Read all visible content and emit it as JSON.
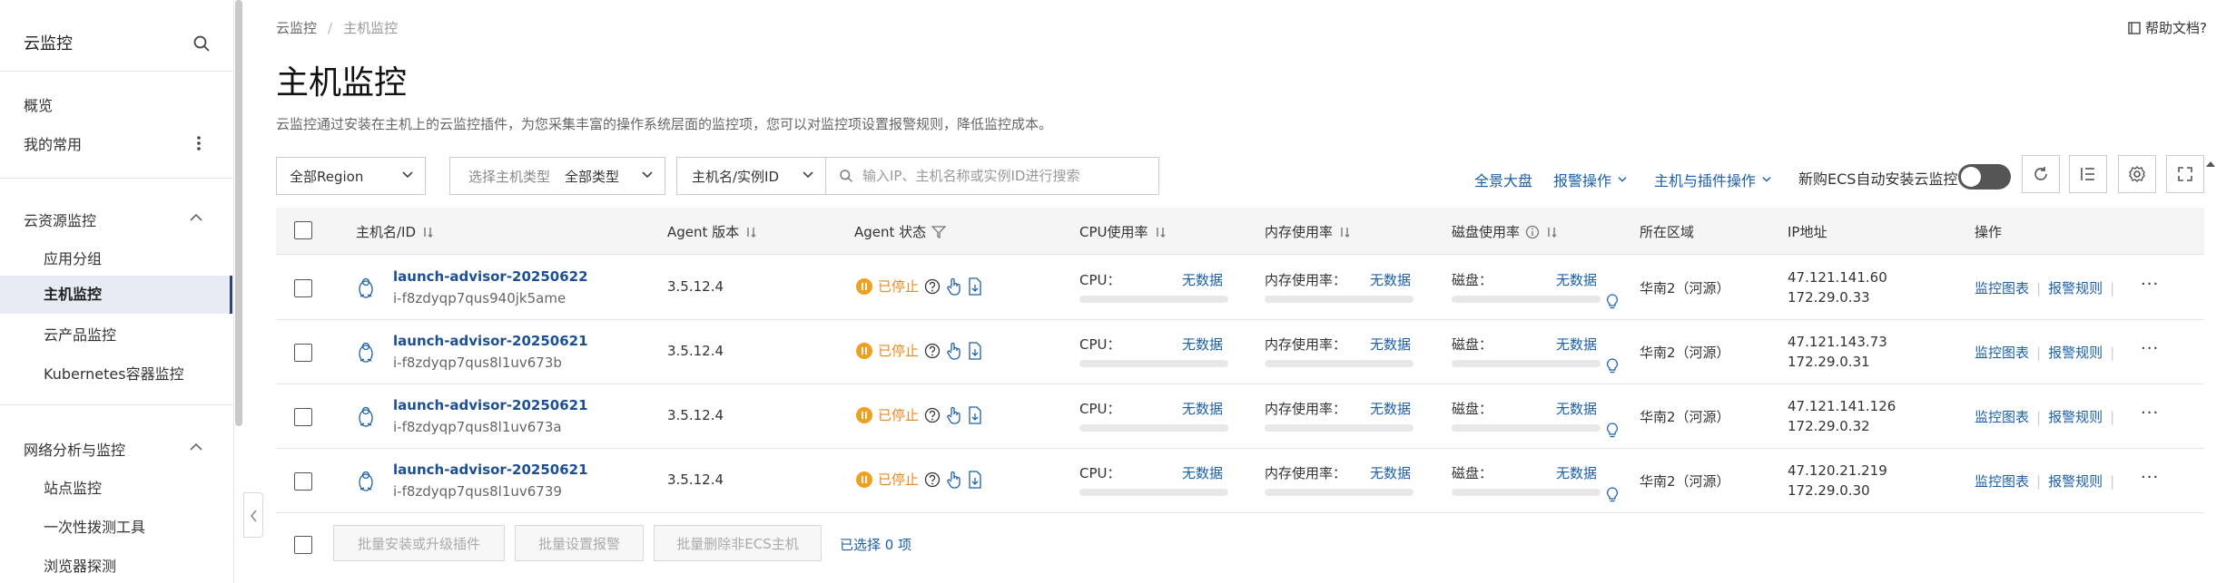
{
  "sidebar": {
    "title": "云监控",
    "items": [
      {
        "label": "概览"
      },
      {
        "label": "我的常用"
      }
    ],
    "groups": [
      {
        "label": "云资源监控",
        "children": [
          "应用分组",
          "主机监控",
          "云产品监控",
          "Kubernetes容器监控"
        ]
      },
      {
        "label": "网络分析与监控",
        "children": [
          "站点监控",
          "一次性拨测工具",
          "浏览器探测"
        ]
      }
    ]
  },
  "breadcrumb": {
    "root": "云监控",
    "current": "主机监控"
  },
  "help_label": "帮助文档?",
  "page": {
    "title": "主机监控",
    "description": "云监控通过安装在主机上的云监控插件，为您采集丰富的操作系统层面的监控项，您可以对监控项设置报警规则，降低监控成本。"
  },
  "toolbar": {
    "region": "全部Region",
    "host_type_label": "选择主机类型",
    "host_type_value": "全部类型",
    "search_field": "主机名/实例ID",
    "search_placeholder": "输入IP、主机名称或实例ID进行搜索",
    "links": [
      "全景大盘",
      "报警操作",
      "主机与插件操作"
    ],
    "auto_install_label": "新购ECS自动安装云监控"
  },
  "table": {
    "headers": [
      "主机名/ID",
      "Agent 版本",
      "Agent 状态",
      "CPU使用率",
      "内存使用率",
      "磁盘使用率",
      "所在区域",
      "IP地址",
      "操作"
    ],
    "metric_labels": {
      "cpu": "CPU：",
      "mem": "内存使用率：",
      "disk": "磁盘："
    },
    "no_data": "无数据",
    "actions": {
      "chart": "监控图表",
      "alarm": "报警规则",
      "more": "···"
    },
    "rows": [
      {
        "name": "launch-advisor-20250622",
        "id": "i-f8zdyqp7qus940jk5ame",
        "version": "3.5.12.4",
        "status": "已停止",
        "region": "华南2（河源）",
        "ip1": "47.121.141.60",
        "ip2": "172.29.0.33"
      },
      {
        "name": "launch-advisor-20250621",
        "id": "i-f8zdyqp7qus8l1uv673b",
        "version": "3.5.12.4",
        "status": "已停止",
        "region": "华南2（河源）",
        "ip1": "47.121.143.73",
        "ip2": "172.29.0.31"
      },
      {
        "name": "launch-advisor-20250621",
        "id": "i-f8zdyqp7qus8l1uv673a",
        "version": "3.5.12.4",
        "status": "已停止",
        "region": "华南2（河源）",
        "ip1": "47.121.141.126",
        "ip2": "172.29.0.32"
      },
      {
        "name": "launch-advisor-20250621",
        "id": "i-f8zdyqp7qus8l1uv6739",
        "version": "3.5.12.4",
        "status": "已停止",
        "region": "华南2（河源）",
        "ip1": "47.120.21.219",
        "ip2": "172.29.0.30"
      }
    ]
  },
  "footer": {
    "buttons": [
      "批量安装或升级插件",
      "批量设置报警",
      "批量删除非ECS主机"
    ],
    "selected": "已选择 0 项"
  },
  "colors": {
    "accent": "#1c5fa8",
    "status_stopped": "#f0a020",
    "sidebar_active_bg": "#e8eaf4"
  }
}
